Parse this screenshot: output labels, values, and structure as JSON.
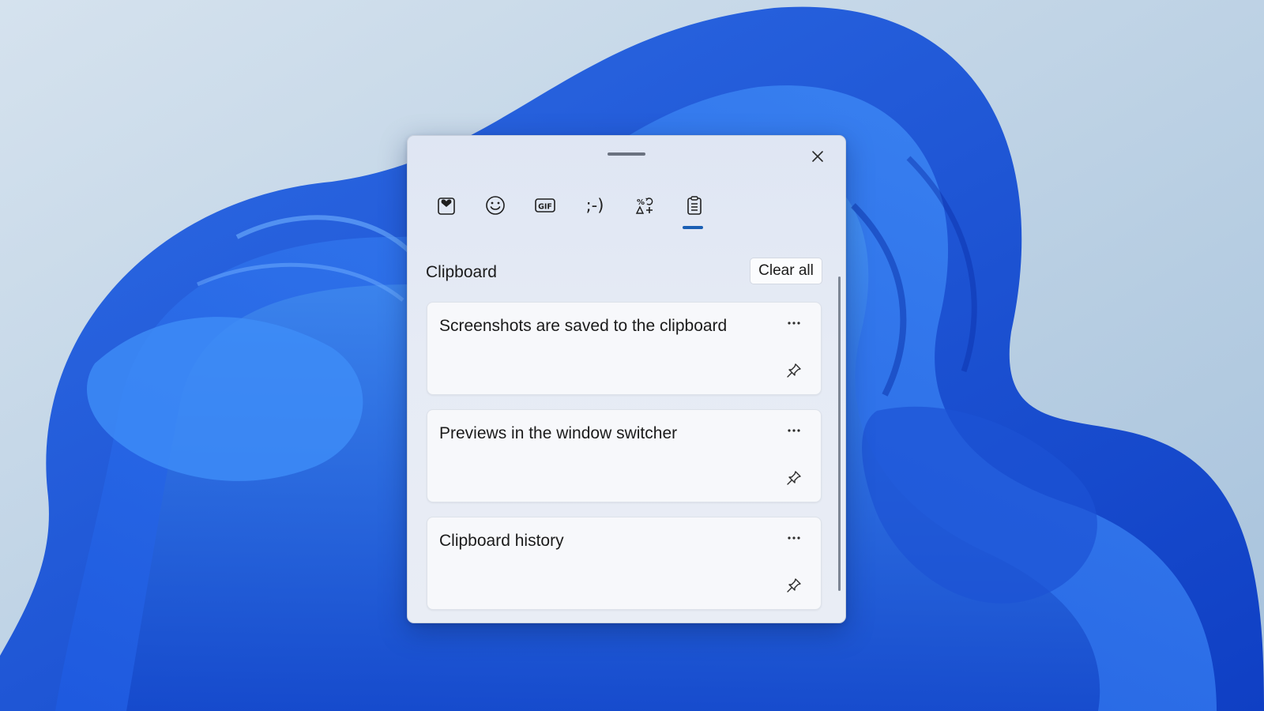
{
  "desktop": {
    "wallpaper": "windows-11-bloom"
  },
  "panel": {
    "tabs": [
      {
        "name": "recently-used",
        "icon": "heart-sticker-icon",
        "selected": false
      },
      {
        "name": "emoji",
        "icon": "smiley-icon",
        "selected": false
      },
      {
        "name": "gif",
        "icon": "gif-icon",
        "selected": false
      },
      {
        "name": "kaomoji",
        "icon": "kaomoji-icon",
        "label": ";-)",
        "selected": false
      },
      {
        "name": "symbols",
        "icon": "symbols-icon",
        "selected": false
      },
      {
        "name": "clipboard",
        "icon": "clipboard-icon",
        "selected": true
      }
    ],
    "title": "Clipboard",
    "clear_all_label": "Clear all",
    "items": [
      {
        "text": "Screenshots are saved to the clipboard"
      },
      {
        "text": "Previews in the window switcher"
      },
      {
        "text": "Clipboard history"
      }
    ]
  },
  "colors": {
    "accent": "#1a5fb4",
    "panel_bg": "#e6ebf5",
    "card_bg": "#f7f8fb"
  }
}
